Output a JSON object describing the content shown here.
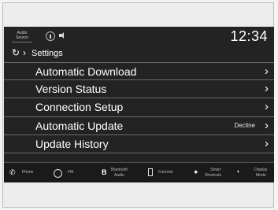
{
  "statusbar": {
    "audio_source_line1": "Audio",
    "audio_source_line2": "Source",
    "time": "12:34"
  },
  "breadcrumb": {
    "title": "Settings"
  },
  "menu": {
    "items": [
      {
        "label": "Automatic Download",
        "value": ""
      },
      {
        "label": "Version Status",
        "value": ""
      },
      {
        "label": "Connection Setup",
        "value": ""
      },
      {
        "label": "Automatic Update",
        "value": "Decline"
      },
      {
        "label": "Update History",
        "value": ""
      }
    ]
  },
  "shortcuts": {
    "phone": "Phone",
    "fm": "FM",
    "bluetooth_line1": "Bluetooth",
    "bluetooth_line2": "Audio",
    "connect": "Connect",
    "smart_line1": "Smart",
    "smart_line2": "Shortcuts",
    "display_line1": "Display",
    "display_line2": "Mode"
  },
  "icons": {
    "back": "back-arrows-icon",
    "antenna": "antenna-icon",
    "speaker": "speaker-icon",
    "phone": "phone-icon",
    "fm": "radio-icon",
    "bluetooth": "bluetooth-icon",
    "connect": "smartphone-icon",
    "smart": "smart-shortcuts-icon",
    "display": "display-mode-icon"
  }
}
